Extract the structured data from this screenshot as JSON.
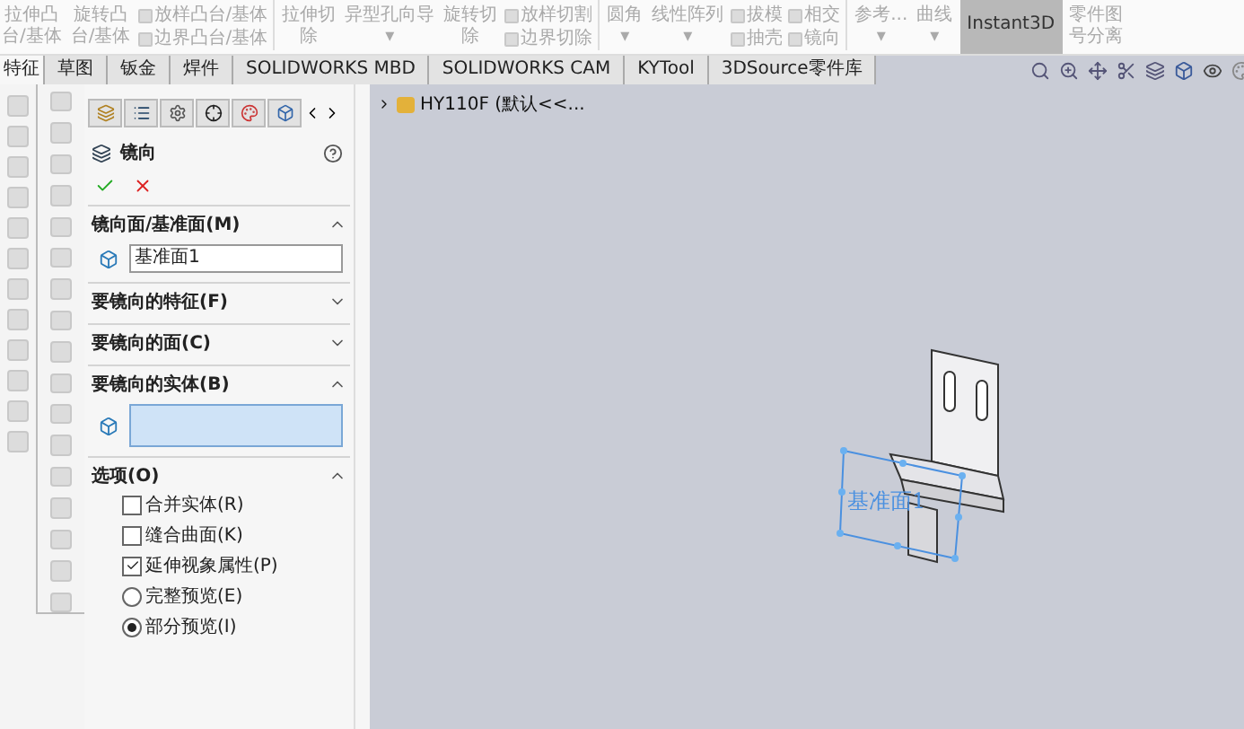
{
  "ribbon": {
    "groups": [
      {
        "items": [
          {
            "kind": "large",
            "lines": [
              "拉伸凸",
              "台/基体"
            ]
          },
          {
            "kind": "large",
            "lines": [
              "旋转凸",
              "台/基体"
            ]
          },
          {
            "kind": "small",
            "lines": [
              "放样凸台/基体",
              "边界凸台/基体"
            ]
          }
        ]
      },
      {
        "items": [
          {
            "kind": "large",
            "lines": [
              "拉伸切",
              "除"
            ]
          },
          {
            "kind": "large",
            "lines": [
              "异型孔向导",
              "▾"
            ]
          },
          {
            "kind": "large",
            "lines": [
              "旋转切",
              "除"
            ]
          },
          {
            "kind": "small",
            "lines": [
              "放样切割",
              "边界切除"
            ]
          }
        ]
      },
      {
        "items": [
          {
            "kind": "large",
            "lines": [
              "圆角",
              "▾"
            ]
          },
          {
            "kind": "large",
            "lines": [
              "线性阵列",
              "▾"
            ]
          },
          {
            "kind": "small",
            "lines": [
              "拔模",
              "抽壳"
            ]
          },
          {
            "kind": "small",
            "lines": [
              "相交",
              "镜向"
            ]
          }
        ]
      },
      {
        "items": [
          {
            "kind": "large",
            "lines": [
              "参考...",
              "▾"
            ]
          },
          {
            "kind": "large",
            "lines": [
              "曲线",
              "▾"
            ]
          },
          {
            "kind": "toggle",
            "lines": [
              "Instant3D"
            ],
            "on": true
          },
          {
            "kind": "large",
            "lines": [
              "零件图",
              "号分离"
            ]
          }
        ]
      }
    ]
  },
  "tabs": [
    {
      "label": "特征",
      "selected": true
    },
    {
      "label": "草图",
      "selected": false
    },
    {
      "label": "钣金",
      "selected": false
    },
    {
      "label": "焊件",
      "selected": false
    },
    {
      "label": "SOLIDWORKS MBD",
      "selected": false
    },
    {
      "label": "SOLIDWORKS CAM",
      "selected": false
    },
    {
      "label": "KYTool",
      "selected": false
    },
    {
      "label": "3DSource零件库",
      "selected": false
    }
  ],
  "property_manager": {
    "title": "镜向",
    "sections": [
      {
        "kind": "field",
        "title": "镜向面/基准面(M)",
        "expanded": true,
        "value": "基准面1"
      },
      {
        "title": "要镜向的特征(F)",
        "expanded": false
      },
      {
        "title": "要镜向的面(C)",
        "expanded": false
      },
      {
        "kind": "selection",
        "title": "要镜向的实体(B)",
        "expanded": true
      },
      {
        "kind": "options",
        "title": "选项(O)",
        "expanded": true,
        "options": [
          {
            "kind": "checkbox",
            "label": "合并实体(R)",
            "checked": false
          },
          {
            "kind": "checkbox",
            "label": "缝合曲面(K)",
            "checked": false
          },
          {
            "kind": "checkbox",
            "label": "延伸视象属性(P)",
            "checked": true
          },
          {
            "kind": "radio",
            "label": "完整预览(E)",
            "checked": false
          },
          {
            "kind": "radio",
            "label": "部分预览(I)",
            "checked": true
          }
        ]
      }
    ]
  },
  "graphics": {
    "tree_item": "HY110F (默认<<...",
    "plane_label": "基准面1"
  }
}
